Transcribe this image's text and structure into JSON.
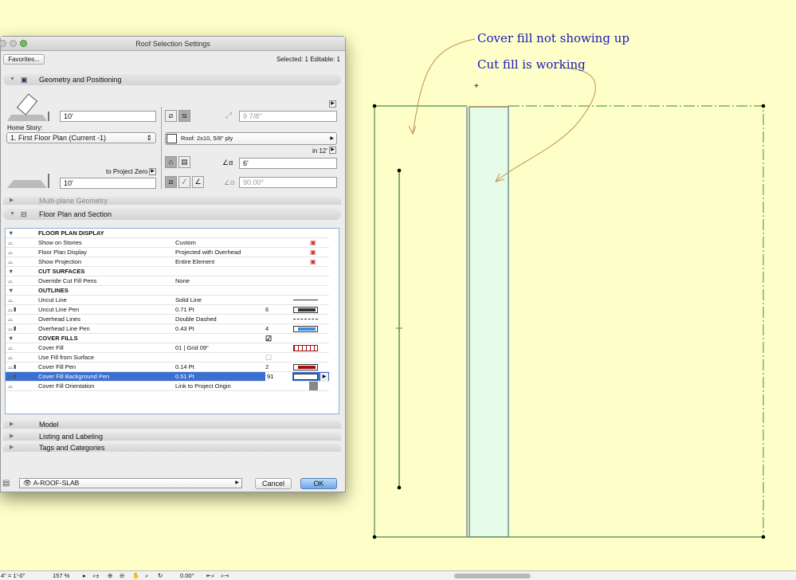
{
  "annotations": {
    "cover_note": "Cover fill not showing up",
    "cut_note": "Cut fill is working"
  },
  "colors": {
    "background": "#fefec8",
    "cut_fill": "#e6fbe8",
    "outline": "#4a8a4a",
    "note_text": "#1a1ab8",
    "selection": "#3b6fd0"
  },
  "dialog": {
    "title": "Roof Selection Settings",
    "favorites_label": "Favorites...",
    "selection_info": "Selected: 1 Editable: 1",
    "sections": {
      "geometry": "Geometry and Positioning",
      "multiplane": "Multi-plane Geometry",
      "floorplan": "Floor Plan and Section",
      "model": "Model",
      "listing": "Listing and Labeling",
      "tags": "Tags and Categories"
    },
    "geometry": {
      "pivot_height": "10'",
      "home_story_label": "Home Story:",
      "home_story_value": "1. First Floor Plan (Current -1)",
      "to_project_zero_label": "to Project Zero",
      "elevation": "10'",
      "thickness": "9 7/8\"",
      "building_material": "Roof: 2x10, 5/8\" ply",
      "pitch_unit": "in 12'",
      "pitch": "6'",
      "edge_angle": "90.00°"
    },
    "properties": [
      {
        "type": "header",
        "name": "FLOOR PLAN DISPLAY"
      },
      {
        "name": "Show on Stories",
        "value": "Custom",
        "icon": "stories-icon"
      },
      {
        "name": "Floor Plan Display",
        "value": "Projected with Overhead",
        "icon": "display-icon"
      },
      {
        "name": "Show Projection",
        "value": "Entire Element",
        "icon": "projection-icon"
      },
      {
        "type": "header",
        "name": "CUT SURFACES"
      },
      {
        "name": "Override Cut Fill Pens",
        "value": "None"
      },
      {
        "type": "header",
        "name": "OUTLINES"
      },
      {
        "name": "Uncut Line",
        "value": "Solid Line",
        "line": "solid"
      },
      {
        "name": "Uncut Line Pen",
        "value": "0.71 Pt",
        "pen": "6",
        "pen_color": "#333333"
      },
      {
        "name": "Overhead Lines",
        "value": "Double Dashed",
        "line": "dashed"
      },
      {
        "name": "Overhead Line Pen",
        "value": "0.43 Pt",
        "pen": "4",
        "pen_color": "#3a8de0"
      },
      {
        "type": "header",
        "name": "COVER FILLS",
        "checked": true
      },
      {
        "name": "Cover Fill",
        "value": "01 | Grid 09\"",
        "fill": "grid"
      },
      {
        "name": "Use Fill from Surface",
        "checkbox": false
      },
      {
        "name": "Cover Fill Pen",
        "value": "0.14 Pt",
        "pen": "2",
        "pen_color": "#a01010"
      },
      {
        "name": "Cover Fill Background Pen",
        "value": "0.51 Pt",
        "pen": "91",
        "pen_color": "#ffffff",
        "selected": true
      },
      {
        "name": "Cover Fill Orientation",
        "value": "Link to Project Origin",
        "fill": "solid-gray"
      }
    ],
    "layer": "A-ROOF-SLAB",
    "cancel_label": "Cancel",
    "ok_label": "OK"
  },
  "status_bar": {
    "scale": "4\" = 1'-0\"",
    "zoom": "157 %",
    "angle": "0.00°"
  }
}
